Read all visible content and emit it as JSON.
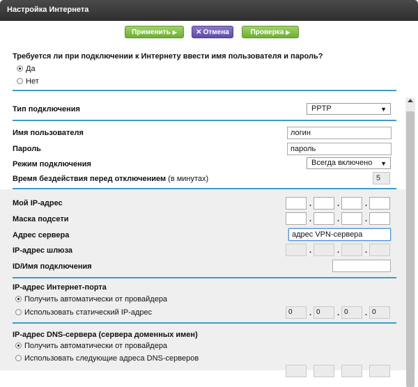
{
  "title": "Настройка Интернета",
  "toolbar": {
    "apply_label": "Применить",
    "cancel_label": "Отмена",
    "test_label": "Проверка",
    "arrow": "▶",
    "cancel_icon": "✕"
  },
  "login_question": {
    "text": "Требуется ли при подключении к Интернету ввести имя пользователя и пароль?",
    "options": [
      "Да",
      "Нет"
    ],
    "selected": "Да"
  },
  "connection_type": {
    "label": "Тип подключения",
    "value": "PPTP"
  },
  "username": {
    "label": "Имя пользователя",
    "value": "логин"
  },
  "password": {
    "label": "Пароль",
    "value": "пароль"
  },
  "connection_mode": {
    "label": "Режим подключения",
    "value": "Всегда включено"
  },
  "idle_timeout": {
    "label": "Время бездействия перед отключением",
    "unit": "(в минутах)",
    "value": "5"
  },
  "my_ip": {
    "label": "Мой IP-адрес"
  },
  "subnet_mask": {
    "label": "Маска подсети"
  },
  "server_address": {
    "label": "Адрес сервера",
    "value": "адрес VPN-сервера"
  },
  "gateway_ip": {
    "label": "IP-адрес шлюза"
  },
  "connection_id": {
    "label": "ID/Имя подключения",
    "value": ""
  },
  "internet_port_ip": {
    "heading": "IP-адрес Интернет-порта",
    "options": [
      "Получить автоматически от провайдера",
      "Использовать статический IP-адрес"
    ],
    "selected": "Получить автоматически от провайдера",
    "static_octets": [
      "0",
      "0",
      "0",
      "0"
    ]
  },
  "dns": {
    "heading": "IP-адрес DNS-сервера (сервера доменных имен)",
    "options": [
      "Получить автоматически от провайдера",
      "Использовать следующие адреса DNS-серверов"
    ],
    "selected": "Получить автоматически от провайдера"
  },
  "colors": {
    "accent_rule": "#3a9cc4",
    "apply_button": "#7bbb3f",
    "cancel_button": "#6a57b4",
    "title_bar": "#3a3a3a"
  },
  "icons": {
    "dropdown": "chevron-down-icon",
    "scroll_up": "arrow-up-icon"
  }
}
